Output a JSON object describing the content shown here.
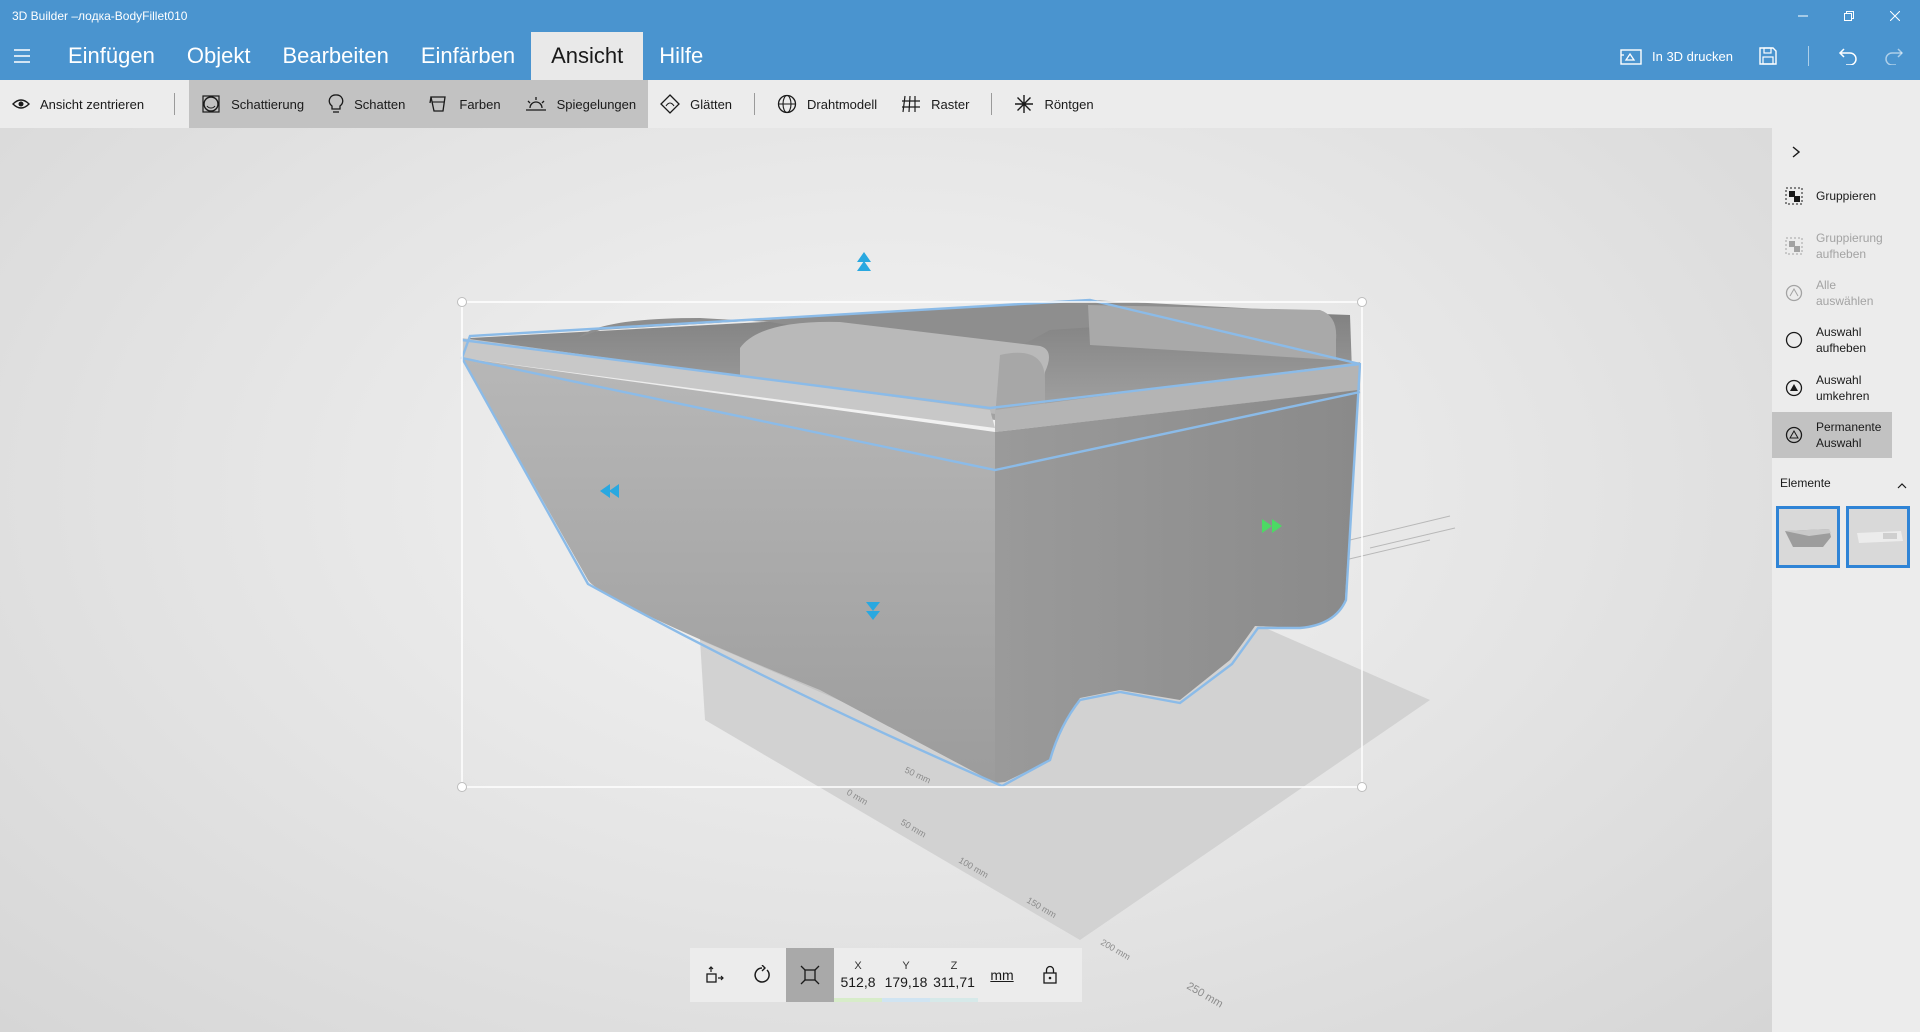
{
  "window": {
    "title": "3D Builder –лодка-BodyFillet010"
  },
  "menu": {
    "tabs": [
      {
        "label": "Einfügen"
      },
      {
        "label": "Objekt"
      },
      {
        "label": "Bearbeiten"
      },
      {
        "label": "Einfärben"
      },
      {
        "label": "Ansicht",
        "active": true
      },
      {
        "label": "Hilfe"
      }
    ],
    "print_label": "In 3D drucken"
  },
  "ribbon": {
    "center_view": "Ansicht zentrieren",
    "shading": "Schattierung",
    "shadows": "Schatten",
    "colors": "Farben",
    "reflections": "Spiegelungen",
    "smooth": "Glätten",
    "wireframe": "Drahtmodell",
    "grid": "Raster",
    "xray": "Röntgen"
  },
  "panel": {
    "group": "Gruppieren",
    "ungroup": "Gruppierung aufheben",
    "select_all": "Alle auswählen",
    "deselect": "Auswahl aufheben",
    "invert": "Auswahl umkehren",
    "permanent": "Permanente Auswahl",
    "elements_header": "Elemente"
  },
  "grid_labels": [
    "50 mm",
    "0 mm",
    "50 mm",
    "100 mm",
    "150 mm",
    "200 mm",
    "250 mm"
  ],
  "transform": {
    "x_label": "X",
    "x_value": "512,8",
    "y_label": "Y",
    "y_value": "179,18",
    "z_label": "Z",
    "z_value": "311,71",
    "unit": "mm"
  },
  "colors": {
    "accent": "#4a94cf",
    "selection": "#2f84d6",
    "handle_blue": "#29a8e0",
    "handle_green": "#4cd964"
  }
}
